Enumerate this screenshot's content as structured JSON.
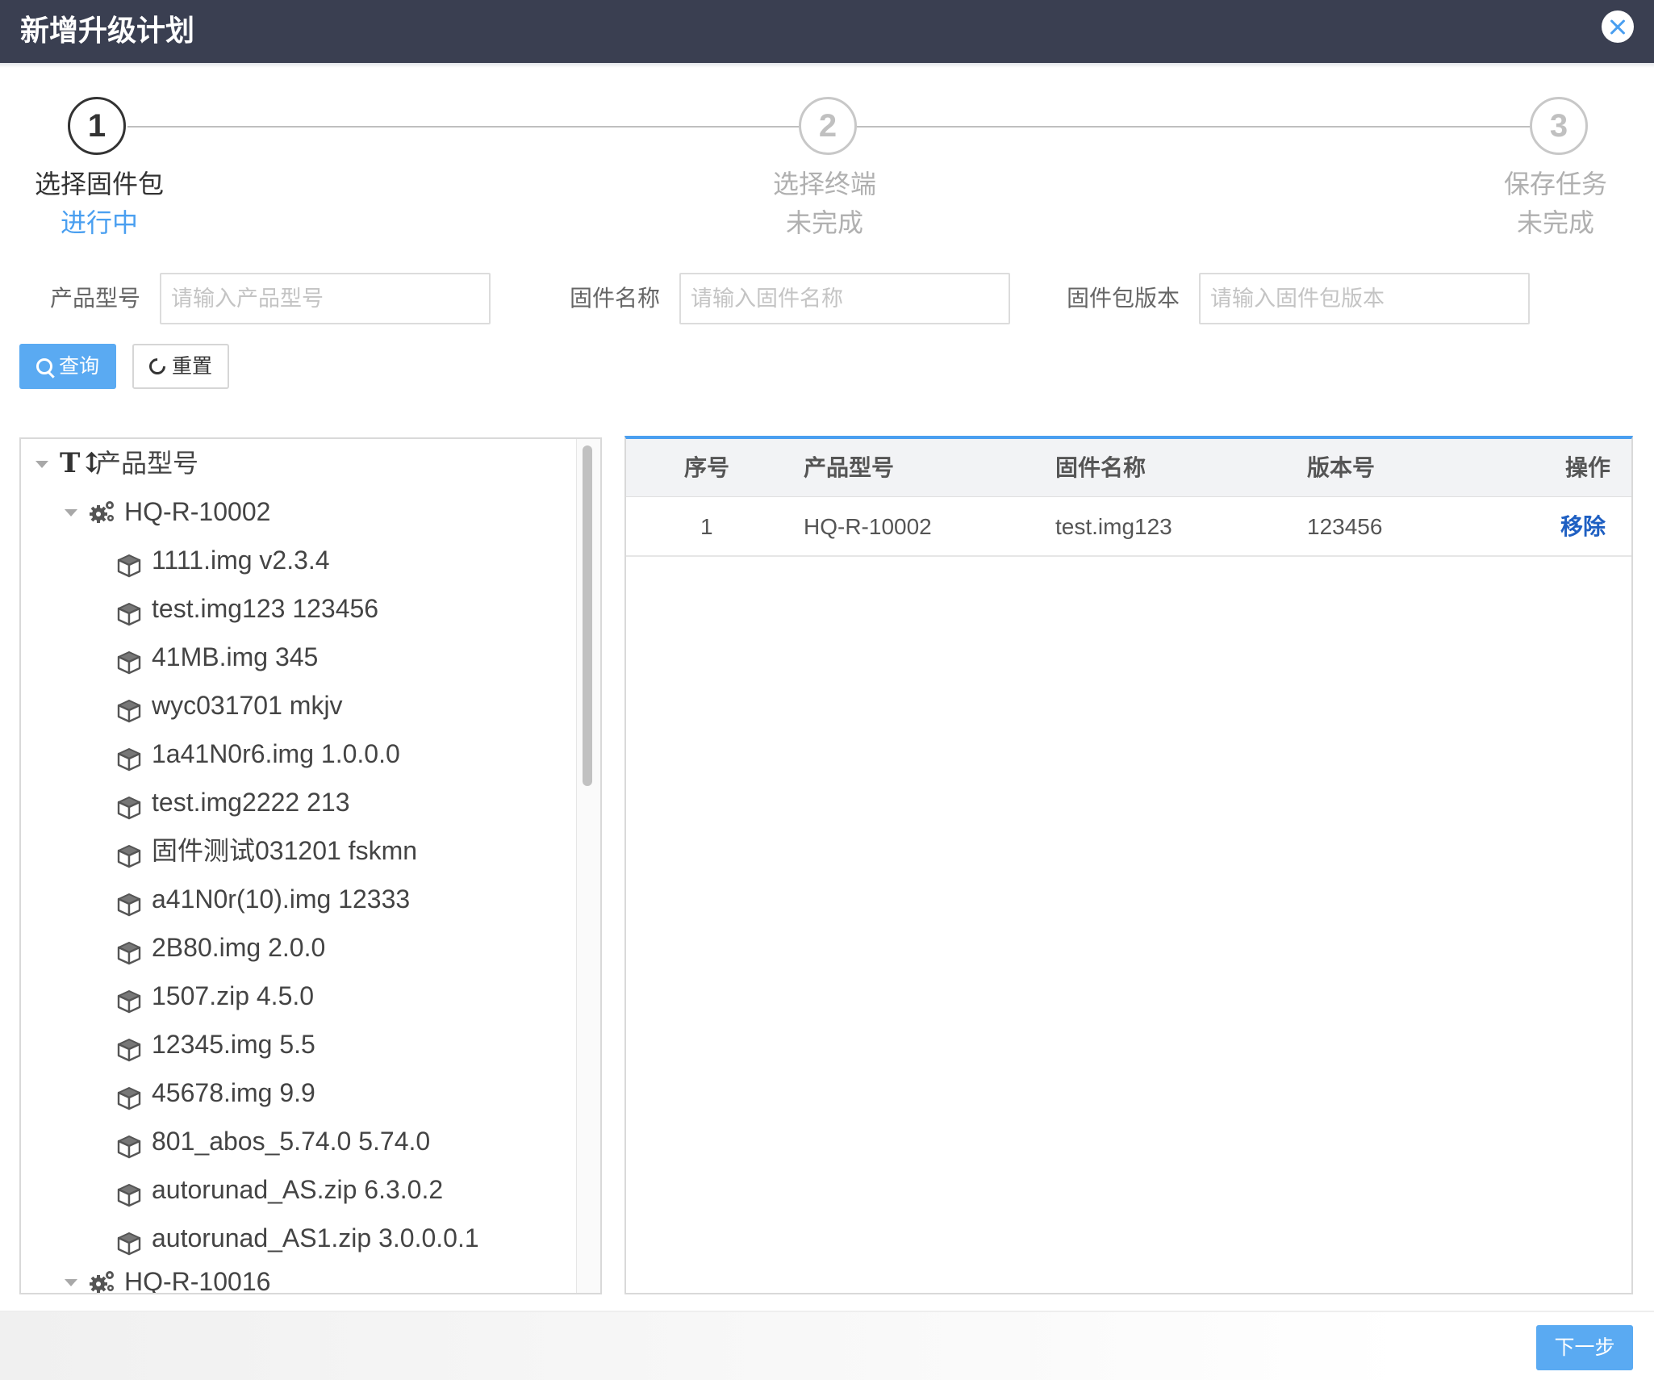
{
  "dialog": {
    "title": "新增升级计划"
  },
  "steps": [
    {
      "number": "1",
      "name": "选择固件包",
      "status": "进行中"
    },
    {
      "number": "2",
      "name": "选择终端",
      "status": "未完成"
    },
    {
      "number": "3",
      "name": "保存任务",
      "status": "未完成"
    }
  ],
  "filters": {
    "product_model": {
      "label": "产品型号",
      "placeholder": "请输入产品型号"
    },
    "firmware_name": {
      "label": "固件名称",
      "placeholder": "请输入固件名称"
    },
    "package_version": {
      "label": "固件包版本",
      "placeholder": "请输入固件包版本"
    }
  },
  "buttons": {
    "query": "查询",
    "reset": "重置",
    "next": "下一步"
  },
  "tree": {
    "root_label": "产品型号",
    "groups": [
      {
        "label": "HQ-R-10002",
        "items": [
          "1111.img v2.3.4",
          "test.img123 123456",
          "41MB.img 345",
          "wyc031701 mkjv",
          "1a41N0r6.img 1.0.0.0",
          "test.img2222 213",
          "固件测试031201 fskmn",
          "a41N0r(10).img 12333",
          "2B80.img 2.0.0",
          "1507.zip 4.5.0",
          "12345.img 5.5",
          "45678.img 9.9",
          "801_abos_5.74.0 5.74.0",
          "autorunad_AS.zip 6.3.0.2",
          "autorunad_AS1.zip 3.0.0.0.1"
        ]
      },
      {
        "label": "HQ-R-10016",
        "items": []
      }
    ]
  },
  "table": {
    "columns": [
      "序号",
      "产品型号",
      "固件名称",
      "版本号",
      "操作"
    ],
    "rows": [
      {
        "index": "1",
        "product_model": "HQ-R-10002",
        "firmware_name": "test.img123",
        "version": "123456",
        "action": "移除"
      }
    ]
  }
}
